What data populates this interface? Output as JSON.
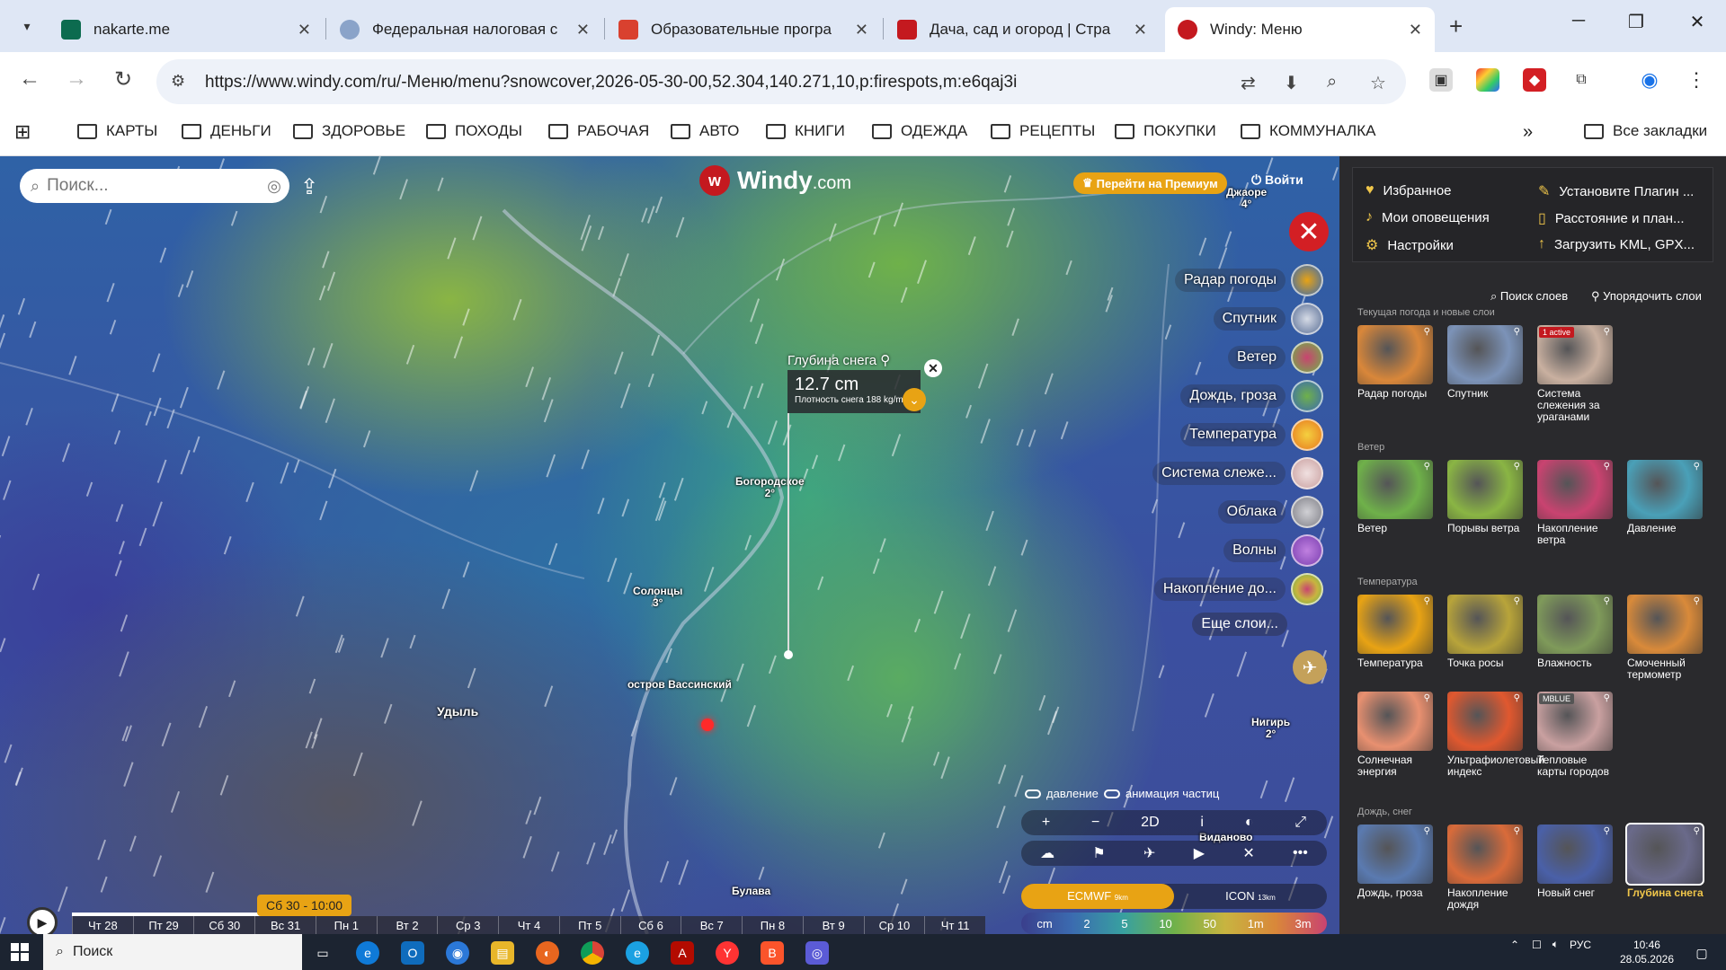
{
  "browser": {
    "tabs": [
      {
        "title": "nakarte.me",
        "color": "#0c6b4f"
      },
      {
        "title": "Федеральная налоговая с",
        "color": "#8aa3c9"
      },
      {
        "title": "Образовательные програ",
        "color": "#d9412f"
      },
      {
        "title": "Дача, сад и огород | Стра",
        "color": "#c4191f"
      },
      {
        "title": "Windy: Меню",
        "color": "#c4191f"
      }
    ],
    "url": "https://www.windy.com/ru/-Меню/menu?snowcover,2026-05-30-00,52.304,140.271,10,p:firespots,m:e6qaj3i",
    "bookmarks": [
      "КАРТЫ",
      "ДЕНЬГИ",
      "ЗДОРОВЬЕ",
      "ПОХОДЫ",
      "РАБОЧАЯ",
      "АВТО",
      "КНИГИ",
      "ОДЕЖДА",
      "РЕЦЕПТЫ",
      "ПОКУПКИ",
      "КОММУНАЛКА"
    ],
    "all_bookmarks": "Все закладки"
  },
  "map": {
    "logo": "Windy",
    "logo_domain": ".com",
    "search_placeholder": "Поиск...",
    "premium": "Перейти на Премиум",
    "login": "Войти",
    "layers": [
      {
        "label": "Радар погоды",
        "color": "#d9873a"
      },
      {
        "label": "Спутник",
        "color": "#7c93b8"
      },
      {
        "label": "Ветер",
        "color": "#6fb14a"
      },
      {
        "label": "Дождь, гроза",
        "color": "#3b6bb0"
      },
      {
        "label": "Температура",
        "color": "#e8791f"
      },
      {
        "label": "Система слеже...",
        "color": "#c9a0a0"
      },
      {
        "label": "Облака",
        "color": "#9a9aa0"
      },
      {
        "label": "Волны",
        "color": "#7a3fb0"
      },
      {
        "label": "Накопление до...",
        "color": "#c8b440"
      }
    ],
    "more_layers": "Еще слои...",
    "towns": [
      {
        "name": "Джаоре",
        "temp": "4°"
      },
      {
        "name": "Богородское",
        "temp": "2°"
      },
      {
        "name": "Солонцы",
        "temp": "3°"
      },
      {
        "name": "остров Вассинский",
        "temp": ""
      },
      {
        "name": "Удыль",
        "temp": ""
      },
      {
        "name": "Нигирь",
        "temp": "2°"
      },
      {
        "name": "Виданово",
        "temp": ""
      },
      {
        "name": "Булава",
        "temp": ""
      }
    ],
    "popup": {
      "title": "Глубина снега",
      "value": "12.7 cm",
      "sub": "Плотность снега 188 kg/m³"
    },
    "toggles": [
      "давление",
      "анимация частиц"
    ],
    "controls_row1": [
      "+",
      "−",
      "2D",
      "i",
      "◐",
      "⤢"
    ],
    "controls_row2": [
      "☁",
      "⚑",
      "✈",
      "▶",
      "✕",
      "•••"
    ],
    "models": [
      {
        "name": "ECMWF",
        "res": "9km",
        "active": true
      },
      {
        "name": "ICON",
        "res": "13km",
        "active": false
      }
    ],
    "scale": [
      "cm",
      "2",
      "5",
      "10",
      "50",
      "1m",
      "3m"
    ],
    "timeline": {
      "current": "Сб 30 - 10:00",
      "days": [
        "Чт 28",
        "Пт 29",
        "Сб 30",
        "Вс 31",
        "Пн 1",
        "Вт 2",
        "Ср 3",
        "Чт 4",
        "Пт 5",
        "Сб 6",
        "Вс 7",
        "Пн 8",
        "Вт 9",
        "Ср 10",
        "Чт 11"
      ]
    }
  },
  "panel": {
    "quick": [
      {
        "label": "Избранное",
        "icon": "heart-icon"
      },
      {
        "label": "Установите Плагин ...",
        "icon": "plugin-icon"
      },
      {
        "label": "Мои оповещения",
        "icon": "bell-icon"
      },
      {
        "label": "Расстояние и план...",
        "icon": "ruler-icon"
      },
      {
        "label": "Настройки",
        "icon": "gear-icon"
      },
      {
        "label": "Загрузить KML, GPX...",
        "icon": "upload-icon"
      }
    ],
    "search_layers": "Поиск слоев",
    "arrange_layers": "Упорядочить слои",
    "sections": [
      {
        "title": "Текущая погода и новые слои",
        "tiles": [
          {
            "label": "Радар погоды",
            "color": "#d9873a",
            "badge": ""
          },
          {
            "label": "Спутник",
            "color": "#7c93b8",
            "badge": ""
          },
          {
            "label": "Система слежения за ураганами",
            "color": "#c9b0a0",
            "badge": "1 active"
          }
        ]
      },
      {
        "title": "Ветер",
        "tiles": [
          {
            "label": "Ветер",
            "color": "#6fb14a",
            "badge": ""
          },
          {
            "label": "Порывы ветра",
            "color": "#8ab544",
            "badge": ""
          },
          {
            "label": "Накопление ветра",
            "color": "#c94370",
            "badge": ""
          },
          {
            "label": "Давление",
            "color": "#4aa0b8",
            "badge": ""
          }
        ]
      },
      {
        "title": "Температура",
        "tiles": [
          {
            "label": "Температура",
            "color": "#e8a314",
            "badge": ""
          },
          {
            "label": "Точка росы",
            "color": "#b8a43a",
            "badge": ""
          },
          {
            "label": "Влажность",
            "color": "#7f9a5a",
            "badge": ""
          },
          {
            "label": "Смоченный термометр",
            "color": "#d98a3a",
            "badge": ""
          },
          {
            "label": "Солнечная энергия",
            "color": "#e89070",
            "badge": ""
          },
          {
            "label": "Ультрафиолетовый индекс",
            "color": "#e0582f",
            "badge": ""
          },
          {
            "label": "Тепловые карты городов",
            "color": "#c9a0a0",
            "badge": "MBLUE"
          }
        ]
      },
      {
        "title": "Дождь, снег",
        "tiles": [
          {
            "label": "Дождь, гроза",
            "color": "#5a7ab0",
            "badge": ""
          },
          {
            "label": "Накопление дождя",
            "color": "#d96b3a",
            "badge": ""
          },
          {
            "label": "Новый снег",
            "color": "#4a60a8",
            "badge": ""
          },
          {
            "label": "Глубина снега",
            "color": "#6a6a8a",
            "badge": ""
          }
        ]
      }
    ]
  },
  "taskbar": {
    "search": "Поиск",
    "lang": "РУС",
    "time": "10:46",
    "date": "28.05.2026"
  }
}
